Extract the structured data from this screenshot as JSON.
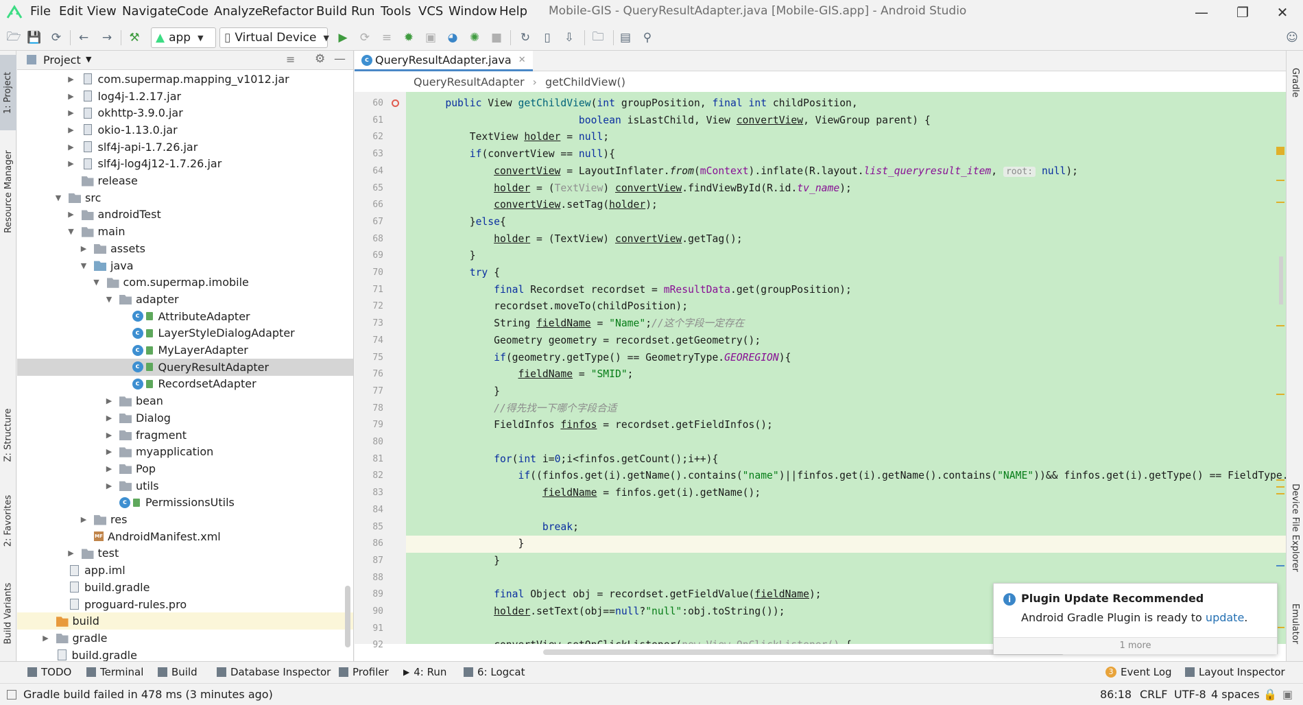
{
  "menu": [
    "File",
    "Edit",
    "View",
    "Navigate",
    "Code",
    "Analyze",
    "Refactor",
    "Build",
    "Run",
    "Tools",
    "VCS",
    "Window",
    "Help"
  ],
  "window_title": "Mobile-GIS - QueryResultAdapter.java [Mobile-GIS.app] - Android Studio",
  "toolbar": {
    "module": "app",
    "device": "Virtual Device"
  },
  "left_tabs": [
    "1: Project",
    "Resource Manager",
    "Z: Structure",
    "2: Favorites",
    "Build Variants"
  ],
  "right_tabs": [
    "Gradle",
    "Device File Explorer",
    "Emulator"
  ],
  "project_panel": {
    "title": "Project",
    "rows": [
      {
        "label": "com.supermap.mapping_v1012.jar",
        "icon": "jar",
        "depth": 3,
        "arrow": "right"
      },
      {
        "label": "log4j-1.2.17.jar",
        "icon": "jar",
        "depth": 3,
        "arrow": "right"
      },
      {
        "label": "okhttp-3.9.0.jar",
        "icon": "jar",
        "depth": 3,
        "arrow": "right"
      },
      {
        "label": "okio-1.13.0.jar",
        "icon": "jar",
        "depth": 3,
        "arrow": "right"
      },
      {
        "label": "slf4j-api-1.7.26.jar",
        "icon": "jar",
        "depth": 3,
        "arrow": "right"
      },
      {
        "label": "slf4j-log4j12-1.7.26.jar",
        "icon": "jar",
        "depth": 3,
        "arrow": "right"
      },
      {
        "label": "release",
        "icon": "folder",
        "depth": 3,
        "arrow": ""
      },
      {
        "label": "src",
        "icon": "folder",
        "depth": 2,
        "arrow": "down"
      },
      {
        "label": "androidTest",
        "icon": "folder",
        "depth": 3,
        "arrow": "right"
      },
      {
        "label": "main",
        "icon": "folder",
        "depth": 3,
        "arrow": "down"
      },
      {
        "label": "assets",
        "icon": "folder",
        "depth": 4,
        "arrow": "right"
      },
      {
        "label": "java",
        "icon": "jfolder",
        "depth": 4,
        "arrow": "down"
      },
      {
        "label": "com.supermap.imobile",
        "icon": "pkg",
        "depth": 5,
        "arrow": "down"
      },
      {
        "label": "adapter",
        "icon": "pkg",
        "depth": 6,
        "arrow": "down"
      },
      {
        "label": "AttributeAdapter",
        "icon": "class",
        "depth": 7,
        "arrow": ""
      },
      {
        "label": "LayerStyleDialogAdapter",
        "icon": "class",
        "depth": 7,
        "arrow": ""
      },
      {
        "label": "MyLayerAdapter",
        "icon": "class",
        "depth": 7,
        "arrow": ""
      },
      {
        "label": "QueryResultAdapter",
        "icon": "class",
        "depth": 7,
        "arrow": "",
        "selected": true
      },
      {
        "label": "RecordsetAdapter",
        "icon": "class",
        "depth": 7,
        "arrow": ""
      },
      {
        "label": "bean",
        "icon": "pkg",
        "depth": 6,
        "arrow": "right"
      },
      {
        "label": "Dialog",
        "icon": "pkg",
        "depth": 6,
        "arrow": "right"
      },
      {
        "label": "fragment",
        "icon": "pkg",
        "depth": 6,
        "arrow": "right"
      },
      {
        "label": "myapplication",
        "icon": "pkg",
        "depth": 6,
        "arrow": "right"
      },
      {
        "label": "Pop",
        "icon": "pkg",
        "depth": 6,
        "arrow": "right"
      },
      {
        "label": "utils",
        "icon": "pkg",
        "depth": 6,
        "arrow": "right"
      },
      {
        "label": "PermissionsUtils",
        "icon": "class",
        "depth": 6,
        "arrow": ""
      },
      {
        "label": "res",
        "icon": "folder",
        "depth": 4,
        "arrow": "right"
      },
      {
        "label": "AndroidManifest.xml",
        "icon": "mf",
        "depth": 4,
        "arrow": ""
      },
      {
        "label": "test",
        "icon": "folder",
        "depth": 3,
        "arrow": "right"
      },
      {
        "label": "app.iml",
        "icon": "file",
        "depth": 2,
        "arrow": ""
      },
      {
        "label": "build.gradle",
        "icon": "file",
        "depth": 2,
        "arrow": ""
      },
      {
        "label": "proguard-rules.pro",
        "icon": "file",
        "depth": 2,
        "arrow": ""
      },
      {
        "label": "build",
        "icon": "orange",
        "depth": 1,
        "arrow": "",
        "highlight": true
      },
      {
        "label": "gradle",
        "icon": "folder",
        "depth": 1,
        "arrow": "right"
      },
      {
        "label": "build.gradle",
        "icon": "file",
        "depth": 1,
        "arrow": ""
      }
    ]
  },
  "editor": {
    "tab": "QueryResultAdapter.java",
    "breadcrumbs": [
      "QueryResultAdapter",
      "getChildView()"
    ],
    "current_line": 86,
    "lines": [
      {
        "n": 60,
        "s": [
          [
            "    ",
            ""
          ],
          [
            "public ",
            "kw"
          ],
          [
            "View ",
            ""
          ],
          [
            "getChildView",
            "fn"
          ],
          [
            "(",
            ""
          ],
          [
            "int ",
            "kw"
          ],
          [
            "groupPosition, ",
            ""
          ],
          [
            "final int ",
            "kw"
          ],
          [
            "childPosition,",
            ""
          ]
        ]
      },
      {
        "n": 61,
        "s": [
          [
            "                          ",
            ""
          ],
          [
            "boolean ",
            "kw"
          ],
          [
            "isLastChild, View ",
            ""
          ],
          [
            "convertView",
            "ul"
          ],
          [
            ", ViewGroup parent) {",
            ""
          ]
        ]
      },
      {
        "n": 62,
        "s": [
          [
            "        TextView ",
            ""
          ],
          [
            "holder",
            "ul"
          ],
          [
            " = ",
            ""
          ],
          [
            "null",
            "kw"
          ],
          [
            ";",
            ""
          ]
        ]
      },
      {
        "n": 63,
        "s": [
          [
            "        ",
            ""
          ],
          [
            "if",
            "kw"
          ],
          [
            "(convertView == ",
            ""
          ],
          [
            "null",
            "kw"
          ],
          [
            "){",
            ""
          ]
        ]
      },
      {
        "n": 64,
        "s": [
          [
            "            ",
            ""
          ],
          [
            "convertView",
            "ul"
          ],
          [
            " = LayoutInflater.",
            ""
          ],
          [
            "from",
            "it"
          ],
          [
            "(",
            ""
          ],
          [
            "mContext",
            "fld"
          ],
          [
            ").inflate(R.layout.",
            ""
          ],
          [
            "list_queryresult_item",
            "fld it"
          ],
          [
            ", ",
            ""
          ],
          [
            "root:",
            "hint"
          ],
          [
            " ",
            ""
          ],
          [
            "null",
            "kw"
          ],
          [
            ");",
            ""
          ]
        ]
      },
      {
        "n": 65,
        "s": [
          [
            "            ",
            ""
          ],
          [
            "holder",
            "ul"
          ],
          [
            " = (",
            ""
          ],
          [
            "TextView",
            "dim"
          ],
          [
            ") ",
            ""
          ],
          [
            "convertView",
            "ul"
          ],
          [
            ".findViewById(R.id.",
            ""
          ],
          [
            "tv_name",
            "fld it"
          ],
          [
            ");",
            ""
          ]
        ]
      },
      {
        "n": 66,
        "s": [
          [
            "            ",
            ""
          ],
          [
            "convertView",
            "ul"
          ],
          [
            ".setTag(",
            ""
          ],
          [
            "holder",
            "ul"
          ],
          [
            ");",
            ""
          ]
        ]
      },
      {
        "n": 67,
        "s": [
          [
            "        }",
            ""
          ],
          [
            "else",
            "kw"
          ],
          [
            "{",
            ""
          ]
        ]
      },
      {
        "n": 68,
        "s": [
          [
            "            ",
            ""
          ],
          [
            "holder",
            "ul"
          ],
          [
            " = (TextView) ",
            ""
          ],
          [
            "convertView",
            "ul"
          ],
          [
            ".getTag();",
            ""
          ]
        ]
      },
      {
        "n": 69,
        "s": [
          [
            "        }",
            ""
          ]
        ]
      },
      {
        "n": 70,
        "s": [
          [
            "        ",
            ""
          ],
          [
            "try ",
            "kw"
          ],
          [
            "{",
            ""
          ]
        ]
      },
      {
        "n": 71,
        "s": [
          [
            "            ",
            ""
          ],
          [
            "final ",
            "kw"
          ],
          [
            "Recordset recordset = ",
            ""
          ],
          [
            "mResultData",
            "fld"
          ],
          [
            ".get(groupPosition);",
            ""
          ]
        ]
      },
      {
        "n": 72,
        "s": [
          [
            "            recordset.moveTo(childPosition);",
            ""
          ]
        ]
      },
      {
        "n": 73,
        "s": [
          [
            "            String ",
            ""
          ],
          [
            "fieldName",
            "ul"
          ],
          [
            " = ",
            ""
          ],
          [
            "\"Name\"",
            "str"
          ],
          [
            ";",
            ""
          ],
          [
            "//这个字段一定存在",
            "cm"
          ]
        ]
      },
      {
        "n": 74,
        "s": [
          [
            "            Geometry geometry = recordset.getGeometry();",
            ""
          ]
        ]
      },
      {
        "n": 75,
        "s": [
          [
            "            ",
            ""
          ],
          [
            "if",
            "kw"
          ],
          [
            "(geometry.getType() == GeometryType.",
            ""
          ],
          [
            "GEOREGION",
            "fld it"
          ],
          [
            "){",
            ""
          ]
        ]
      },
      {
        "n": 76,
        "s": [
          [
            "                ",
            ""
          ],
          [
            "fieldName",
            "ul"
          ],
          [
            " = ",
            ""
          ],
          [
            "\"SMID\"",
            "str"
          ],
          [
            ";",
            ""
          ]
        ]
      },
      {
        "n": 77,
        "s": [
          [
            "            }",
            ""
          ]
        ]
      },
      {
        "n": 78,
        "s": [
          [
            "            ",
            ""
          ],
          [
            "//得先找一下哪个字段合适",
            "cm"
          ]
        ]
      },
      {
        "n": 79,
        "s": [
          [
            "            FieldInfos ",
            ""
          ],
          [
            "finfos",
            "ul"
          ],
          [
            " = recordset.getFieldInfos();",
            ""
          ]
        ]
      },
      {
        "n": 80,
        "s": [
          [
            "",
            ""
          ]
        ]
      },
      {
        "n": 81,
        "s": [
          [
            "            ",
            ""
          ],
          [
            "for",
            "kw"
          ],
          [
            "(",
            ""
          ],
          [
            "int ",
            "kw"
          ],
          [
            "i=",
            ""
          ],
          [
            "0",
            "kw"
          ],
          [
            ";i<finfos.getCount();i++){",
            ""
          ]
        ]
      },
      {
        "n": 82,
        "s": [
          [
            "                ",
            ""
          ],
          [
            "if",
            "kw"
          ],
          [
            "((finfos.get(i).getName().contains(",
            ""
          ],
          [
            "\"name\"",
            "str"
          ],
          [
            ")||finfos.get(i).getName().contains(",
            ""
          ],
          [
            "\"NAME\"",
            "str"
          ],
          [
            "))&& finfos.get(i).getType() == FieldType.",
            ""
          ]
        ]
      },
      {
        "n": 83,
        "s": [
          [
            "                    ",
            ""
          ],
          [
            "fieldName",
            "ul"
          ],
          [
            " = finfos.get(i).getName();",
            ""
          ]
        ]
      },
      {
        "n": 84,
        "s": [
          [
            "",
            ""
          ]
        ]
      },
      {
        "n": 85,
        "s": [
          [
            "                    ",
            ""
          ],
          [
            "break",
            "kw"
          ],
          [
            ";",
            ""
          ]
        ]
      },
      {
        "n": 86,
        "s": [
          [
            "                }",
            ""
          ]
        ]
      },
      {
        "n": 87,
        "s": [
          [
            "            }",
            ""
          ]
        ]
      },
      {
        "n": 88,
        "s": [
          [
            "",
            ""
          ]
        ]
      },
      {
        "n": 89,
        "s": [
          [
            "            ",
            ""
          ],
          [
            "final ",
            "kw"
          ],
          [
            "Object obj = recordset.getFieldValue(",
            ""
          ],
          [
            "fieldName",
            "ul"
          ],
          [
            ");",
            ""
          ]
        ]
      },
      {
        "n": 90,
        "s": [
          [
            "            ",
            ""
          ],
          [
            "holder",
            "ul"
          ],
          [
            ".setText(obj==",
            ""
          ],
          [
            "null",
            "kw"
          ],
          [
            "?",
            ""
          ],
          [
            "\"null\"",
            "str"
          ],
          [
            ":obj.toString());",
            ""
          ]
        ]
      },
      {
        "n": 91,
        "s": [
          [
            "",
            ""
          ]
        ]
      },
      {
        "n": 92,
        "s": [
          [
            "            ",
            ""
          ],
          [
            "convertView",
            "ul"
          ],
          [
            ".setOnClickListener(",
            ""
          ],
          [
            "new View.OnClickListener() ",
            "dim"
          ],
          [
            "{",
            ""
          ]
        ]
      }
    ]
  },
  "notification": {
    "title": "Plugin Update Recommended",
    "body": "Android Gradle Plugin is ready to ",
    "link": "update",
    "tail": ".",
    "more": "1 more"
  },
  "bottom_tabs": [
    "TODO",
    "Terminal",
    "Build",
    "Database Inspector",
    "Profiler",
    "4: Run",
    "6: Logcat"
  ],
  "bottom_right_tabs": [
    "Event Log",
    "Layout Inspector"
  ],
  "event_log_count": "3",
  "status": {
    "message": "Gradle build failed in 478 ms (3 minutes ago)",
    "position": "86:18",
    "line_sep": "CRLF",
    "encoding": "UTF-8",
    "indent": "4 spaces"
  },
  "colors": {
    "code_bg": "#c8ebc8",
    "selection": "#d5d5d5",
    "accent": "#4a88c7",
    "build_folder": "#e89a3c"
  }
}
